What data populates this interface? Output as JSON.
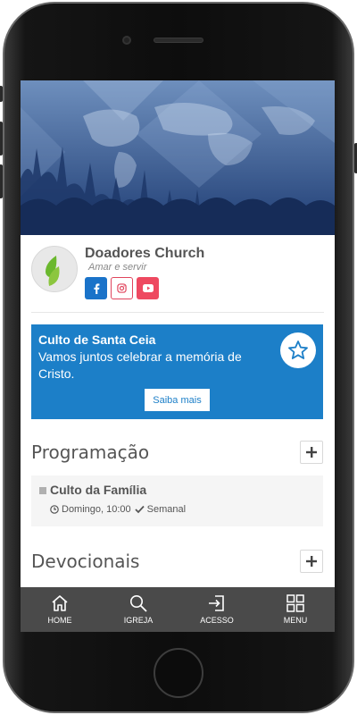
{
  "organization": {
    "name": "Doadores Church",
    "tagline": "Amar e servir"
  },
  "social_links": [
    {
      "name": "facebook",
      "icon": "facebook-icon",
      "color": "#1a73c9"
    },
    {
      "name": "instagram",
      "icon": "instagram-icon",
      "color": "#e0455d"
    },
    {
      "name": "youtube",
      "icon": "youtube-icon",
      "color": "#ee4960"
    }
  ],
  "promo": {
    "title": "Culto de Santa Ceia",
    "text": "Vamos juntos celebrar a memória de Cristo.",
    "button_label": "Saiba mais",
    "background": "#1c7fc8"
  },
  "sections": {
    "programacao": {
      "title": "Programação"
    },
    "devocionais": {
      "title": "Devocionais"
    }
  },
  "events": [
    {
      "title": "Culto da Família",
      "when": "Domingo, 10:00",
      "frequency": "Semanal"
    }
  ],
  "bottom_nav": [
    {
      "label": "HOME",
      "icon": "home-icon"
    },
    {
      "label": "IGREJA",
      "icon": "search-icon"
    },
    {
      "label": "ACESSO",
      "icon": "login-icon"
    },
    {
      "label": "MENU",
      "icon": "grid-icon"
    }
  ],
  "colors": {
    "accent": "#1c7fc8",
    "nav_bg": "#4a4a4a",
    "logo_green": "#6bb82e"
  }
}
